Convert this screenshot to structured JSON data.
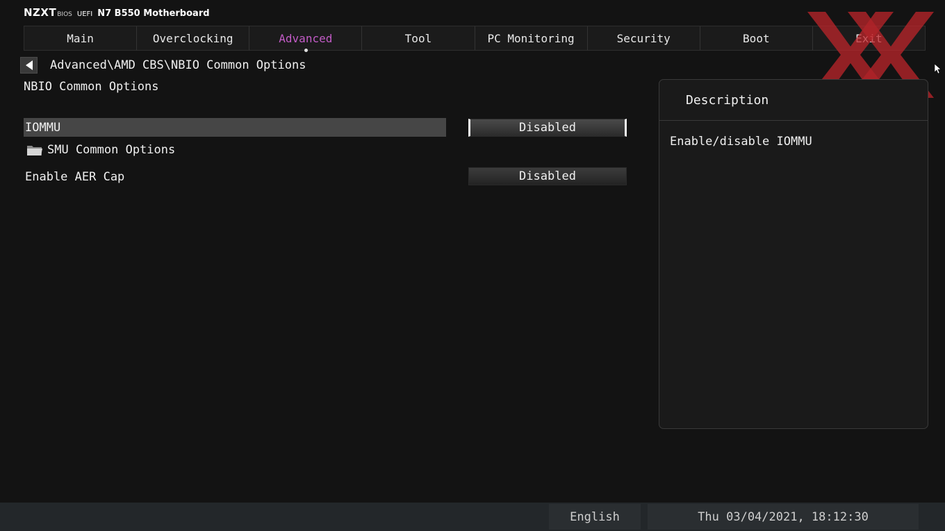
{
  "header": {
    "brand": "NZXT",
    "bios_label": "BIOS",
    "uefi_label": "UEFI",
    "model": "N7 B550 Motherboard"
  },
  "tabs": [
    {
      "label": "Main",
      "active": false
    },
    {
      "label": "Overclocking",
      "active": false
    },
    {
      "label": "Advanced",
      "active": true
    },
    {
      "label": "Tool",
      "active": false
    },
    {
      "label": "PC Monitoring",
      "active": false
    },
    {
      "label": "Security",
      "active": false
    },
    {
      "label": "Boot",
      "active": false
    },
    {
      "label": "Exit",
      "active": false
    }
  ],
  "breadcrumb": "Advanced\\AMD CBS\\NBIO Common Options",
  "section_title": "NBIO Common Options",
  "settings": {
    "iommu": {
      "label": "IOMMU",
      "value": "Disabled"
    },
    "smu_folder": {
      "label": "SMU Common Options"
    },
    "aer_cap": {
      "label": "Enable AER Cap",
      "value": "Disabled"
    }
  },
  "description": {
    "title": "Description",
    "text": "Enable/disable IOMMU"
  },
  "footer": {
    "language": "English",
    "datetime": "Thu 03/04/2021, 18:12:30"
  },
  "colors": {
    "active_tab": "#c25bc6",
    "background": "#131313",
    "watermark": "#c0252b"
  },
  "icons": {
    "back": "back-arrow-icon",
    "folder": "folder-icon"
  }
}
